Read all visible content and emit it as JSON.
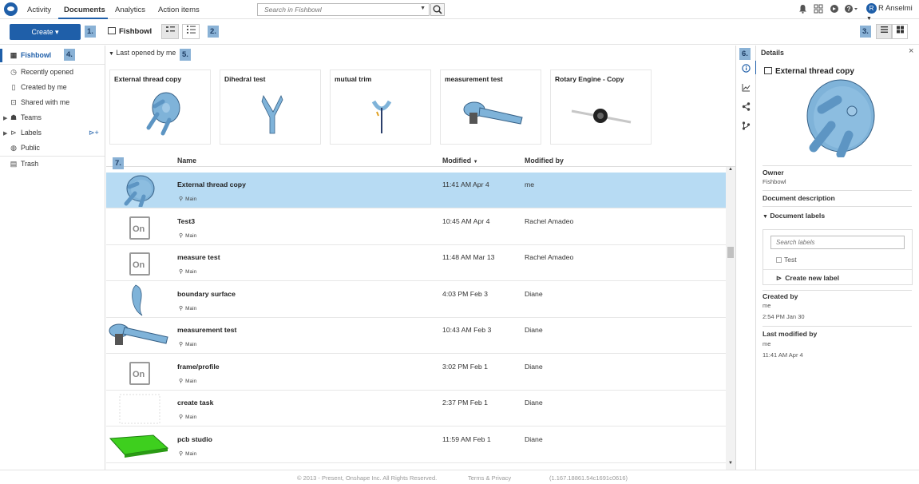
{
  "nav": {
    "tabs": [
      "Activity",
      "Documents",
      "Analytics",
      "Action items"
    ],
    "active_tab": "Documents"
  },
  "search": {
    "placeholder": "Search in Fishbowl"
  },
  "user": {
    "initial": "R",
    "name": "R Anselmi"
  },
  "toolbar": {
    "create_label": "Create ▾",
    "breadcrumb": "Fishbowl"
  },
  "annotations": [
    "1.",
    "2.",
    "3.",
    "4.",
    "5.",
    "6.",
    "7."
  ],
  "sidebar": {
    "items": [
      {
        "label": "Fishbowl",
        "icon": "building-icon"
      },
      {
        "label": "Recently opened",
        "icon": "clock-icon"
      },
      {
        "label": "Created by me",
        "icon": "document-icon"
      },
      {
        "label": "Shared with me",
        "icon": "shared-icon"
      },
      {
        "label": "Teams",
        "icon": "teams-icon"
      },
      {
        "label": "Labels",
        "icon": "label-icon"
      },
      {
        "label": "Public",
        "icon": "globe-icon"
      },
      {
        "label": "Trash",
        "icon": "trash-icon"
      }
    ]
  },
  "recent": {
    "title": "Last opened by me",
    "cards": [
      {
        "title": "External thread copy"
      },
      {
        "title": "Dihedral test"
      },
      {
        "title": "mutual trim"
      },
      {
        "title": "measurement test"
      },
      {
        "title": "Rotary Engine - Copy"
      }
    ]
  },
  "table": {
    "headers": {
      "name": "Name",
      "modified": "Modified",
      "modified_by": "Modified by"
    },
    "sort_indicator": "▼",
    "rows": [
      {
        "name": "External thread copy",
        "branch": "Main",
        "modified": "11:41 AM Apr 4",
        "modified_by": "me",
        "thumb": "part"
      },
      {
        "name": "Test3",
        "branch": "Main",
        "modified": "10:45 AM Apr 4",
        "modified_by": "Rachel Amadeo",
        "thumb": "onshape"
      },
      {
        "name": "measure test",
        "branch": "Main",
        "modified": "11:48 AM Mar 13",
        "modified_by": "Rachel Amadeo",
        "thumb": "onshape"
      },
      {
        "name": "boundary surface",
        "branch": "Main",
        "modified": "4:03 PM Feb 3",
        "modified_by": "Diane",
        "thumb": "surface"
      },
      {
        "name": "measurement test",
        "branch": "Main",
        "modified": "10:43 AM Feb 3",
        "modified_by": "Diane",
        "thumb": "wrench"
      },
      {
        "name": "frame/profile",
        "branch": "Main",
        "modified": "3:02 PM Feb 1",
        "modified_by": "Diane",
        "thumb": "onshape"
      },
      {
        "name": "create task",
        "branch": "Main",
        "modified": "2:37 PM Feb 1",
        "modified_by": "Diane",
        "thumb": "blank"
      },
      {
        "name": "pcb studio",
        "branch": "Main",
        "modified": "11:59 AM Feb 1",
        "modified_by": "Diane",
        "thumb": "pcb"
      }
    ]
  },
  "details": {
    "title": "Details",
    "document_name": "External thread copy",
    "owner_label": "Owner",
    "owner": "Fishbowl",
    "description_label": "Document description",
    "labels_label": "Document labels",
    "search_labels_placeholder": "Search labels",
    "label_option": "Test",
    "create_label": "Create new label",
    "created_by_label": "Created by",
    "created_by": "me",
    "created_at": "2:54 PM Jan 30",
    "last_modified_label": "Last modified by",
    "last_modified_by": "me",
    "last_modified_at": "11:41 AM Apr 4"
  },
  "footer": {
    "copyright": "© 2013 - Present, Onshape Inc. All Rights Reserved.",
    "terms": "Terms & Privacy",
    "version": "(1.167.18861.54c1691c0616)"
  },
  "colors": {
    "accent": "#1f5fa9",
    "selected_row": "#b7dbf3",
    "part_blue": "#7fb3d9"
  }
}
